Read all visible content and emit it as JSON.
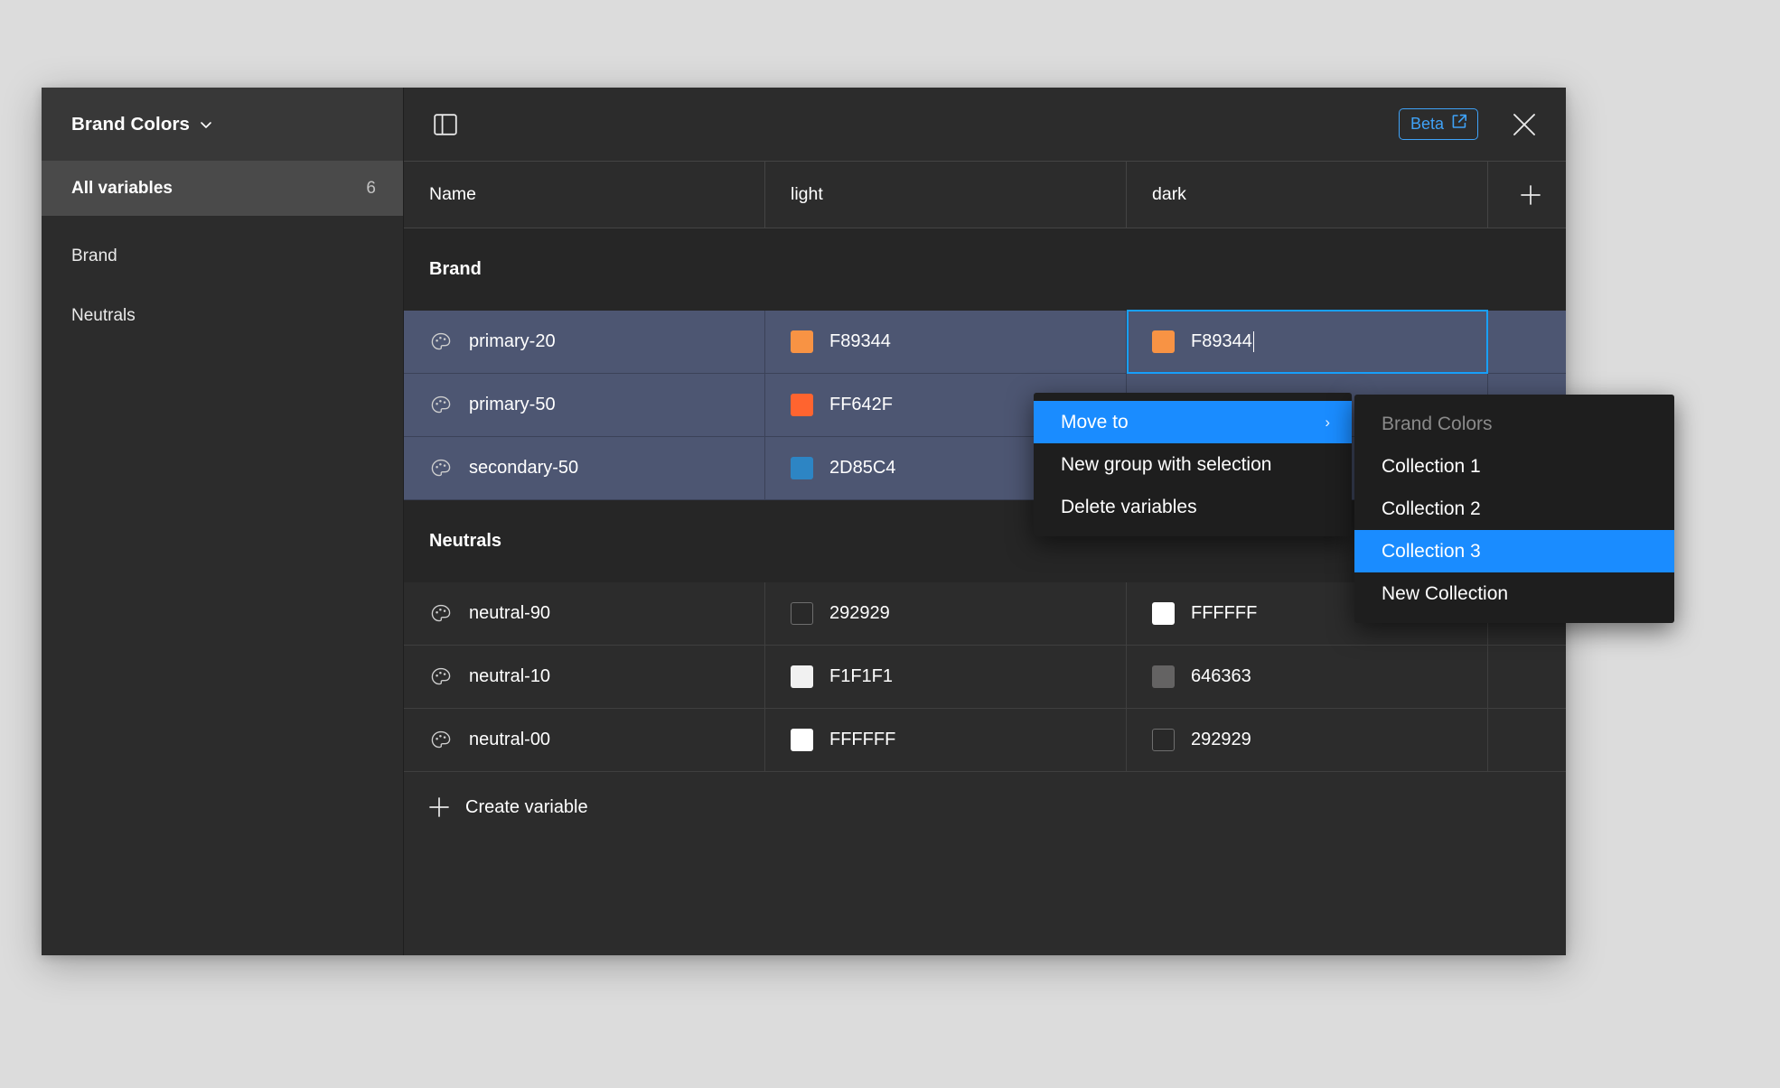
{
  "sidebar": {
    "collection_title": "Brand Colors",
    "chevron_icon": "chevron-down-icon",
    "all_variables": {
      "label": "All variables",
      "count": "6"
    },
    "groups": [
      {
        "label": "Brand"
      },
      {
        "label": "Neutrals"
      }
    ]
  },
  "toolbar": {
    "panel_toggle_icon": "sidebar-toggle-icon",
    "beta_label": "Beta",
    "beta_external_icon": "external-link-icon",
    "close_icon": "close-icon"
  },
  "table": {
    "columns": [
      {
        "label": "Name"
      },
      {
        "label": "light"
      },
      {
        "label": "dark"
      }
    ],
    "add_column_icon": "plus-icon",
    "groups": [
      {
        "name": "Brand",
        "selected": true,
        "rows": [
          {
            "icon": "palette-icon",
            "name": "primary-20",
            "light": {
              "value": "F89344",
              "color": "#F89344",
              "bordered": false
            },
            "dark": {
              "value": "F89344",
              "color": "#F89344",
              "bordered": false,
              "editing": true
            }
          },
          {
            "icon": "palette-icon",
            "name": "primary-50",
            "light": {
              "value": "FF642F",
              "color": "#FF642F",
              "bordered": false
            },
            "dark": {
              "value": "",
              "color": "",
              "bordered": false,
              "editing": false
            }
          },
          {
            "icon": "palette-icon",
            "name": "secondary-50",
            "light": {
              "value": "2D85C4",
              "color": "#2D85C4",
              "bordered": false
            },
            "dark": {
              "value": "",
              "color": "",
              "bordered": false,
              "editing": false
            }
          }
        ]
      },
      {
        "name": "Neutrals",
        "selected": false,
        "rows": [
          {
            "icon": "palette-icon",
            "name": "neutral-90",
            "light": {
              "value": "292929",
              "color": "#292929",
              "bordered": true
            },
            "dark": {
              "value": "FFFFFF",
              "color": "#FFFFFF",
              "bordered": false,
              "editing": false
            }
          },
          {
            "icon": "palette-icon",
            "name": "neutral-10",
            "light": {
              "value": "F1F1F1",
              "color": "#F1F1F1",
              "bordered": false
            },
            "dark": {
              "value": "646363",
              "color": "#646363",
              "bordered": false,
              "editing": false
            }
          },
          {
            "icon": "palette-icon",
            "name": "neutral-00",
            "light": {
              "value": "FFFFFF",
              "color": "#FFFFFF",
              "bordered": false
            },
            "dark": {
              "value": "292929",
              "color": "#292929",
              "bordered": true,
              "editing": false
            }
          }
        ]
      }
    ],
    "create_variable": {
      "label": "Create variable",
      "icon": "plus-icon"
    }
  },
  "context_menu": {
    "items": [
      {
        "label": "Move to",
        "highlight": true,
        "submenu_arrow": "›"
      },
      {
        "label": "New group with selection",
        "highlight": false
      },
      {
        "label": "Delete variables",
        "highlight": false
      }
    ]
  },
  "submenu": {
    "items": [
      {
        "label": "Brand Colors",
        "disabled": true,
        "highlight": false
      },
      {
        "label": "Collection 1",
        "disabled": false,
        "highlight": false
      },
      {
        "label": "Collection 2",
        "disabled": false,
        "highlight": false
      },
      {
        "label": "Collection 3",
        "disabled": false,
        "highlight": true
      },
      {
        "label": "New Collection",
        "disabled": false,
        "highlight": false
      }
    ]
  },
  "colors": {
    "accent_blue": "#18A0FB",
    "menu_highlight": "#1A8CFF",
    "selected_row": "#4D5672",
    "window_bg": "#2C2C2C",
    "page_bg": "#DCDCDC"
  }
}
